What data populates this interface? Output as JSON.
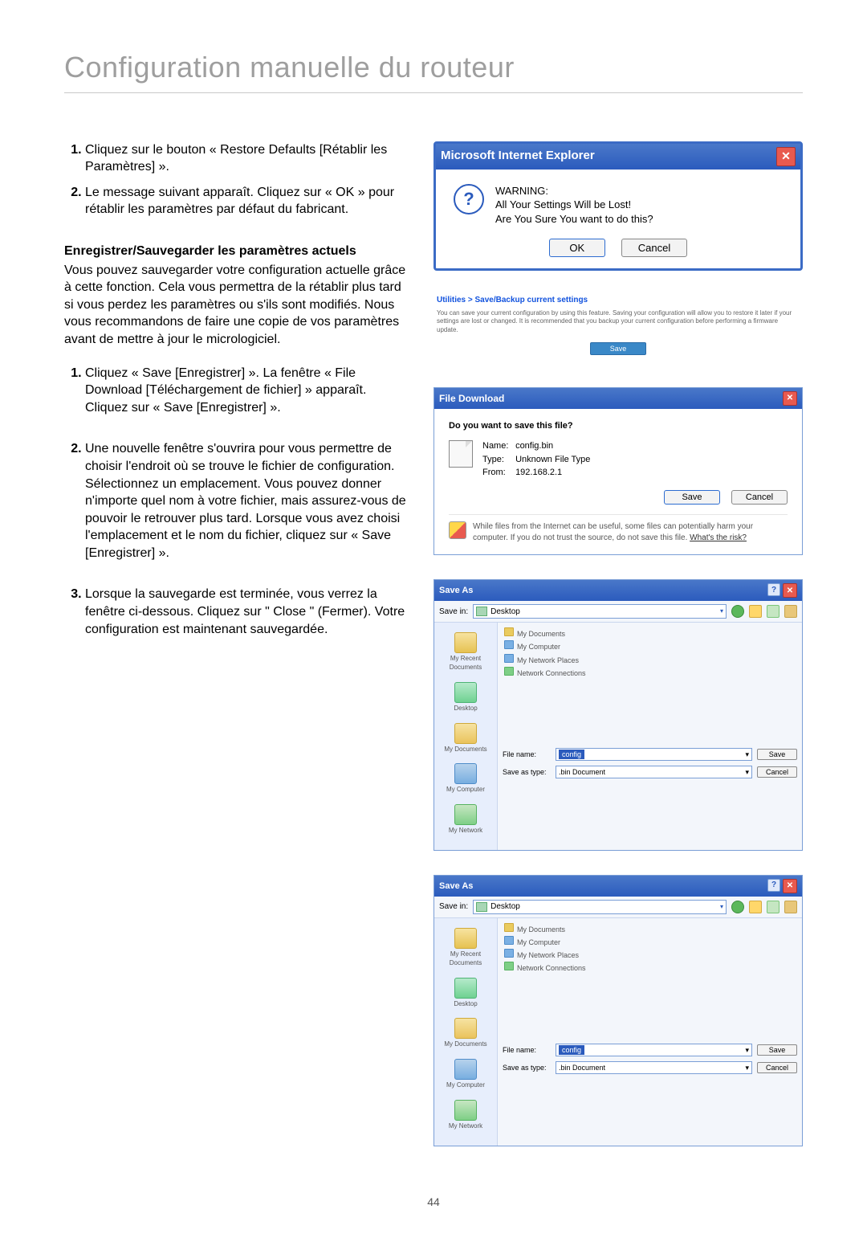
{
  "page": {
    "title": "Configuration manuelle du routeur",
    "number": "44"
  },
  "intro_steps": [
    "Cliquez sur le bouton « Restore Defaults [Rétablir les Paramètres] ».",
    "Le message suivant apparaît. Cliquez sur « OK » pour rétablir les paramètres par défaut du fabricant."
  ],
  "save_section": {
    "heading": "Enregistrer/Sauvegarder les paramètres actuels",
    "paragraph": "Vous pouvez sauvegarder votre configuration actuelle grâce à cette fonction. Cela vous permettra de la rétablir plus tard si vous perdez les paramètres ou s'ils sont modifiés. Nous vous recommandons de faire une copie de vos paramètres avant de mettre à jour le micrologiciel."
  },
  "save_steps": [
    "Cliquez « Save [Enregistrer] ». La fenêtre « File Download [Téléchargement de fichier] » apparaît. Cliquez sur « Save [Enregistrer] ».",
    "Une nouvelle fenêtre s'ouvrira pour vous permettre de choisir l'endroit où se trouve le fichier de configuration. Sélectionnez un emplacement. Vous pouvez donner n'importe quel nom à votre fichier, mais assurez-vous de pouvoir le retrouver plus tard. Lorsque vous avez choisi l'emplacement et le nom du fichier, cliquez sur « Save [Enregistrer] ».",
    "Lorsque la sauvegarde est terminée, vous verrez la fenêtre ci-dessous. Cliquez sur \" Close \" (Fermer). Votre configuration est maintenant sauvegardée."
  ],
  "ie_dialog": {
    "title": "Microsoft Internet Explorer",
    "line1": "WARNING:",
    "line2": "All Your Settings Will be Lost!",
    "line3": "Are You Sure You want to do this?",
    "ok": "OK",
    "cancel": "Cancel"
  },
  "util_panel": {
    "breadcrumb": "Utilities > Save/Backup current settings",
    "desc": "You can save your current configuration by using this feature. Saving your configuration will allow you to restore it later if your settings are lost or changed. It is recommended that you backup your current configuration before performing a firmware update.",
    "save": "Save"
  },
  "file_download": {
    "title": "File Download",
    "prompt": "Do you want to save this file?",
    "name_label": "Name:",
    "name_value": "config.bin",
    "type_label": "Type:",
    "type_value": "Unknown File Type",
    "from_label": "From:",
    "from_value": "192.168.2.1",
    "save": "Save",
    "cancel": "Cancel",
    "note": "While files from the Internet can be useful, some files can potentially harm your computer. If you do not trust the source, do not save this file.",
    "risk": "What's the risk?"
  },
  "saveas_common": {
    "title": "Save As",
    "savein_label": "Save in:",
    "savein_value": "Desktop",
    "side": {
      "recent": "My Recent Documents",
      "desktop": "Desktop",
      "docs": "My Documents",
      "computer": "My Computer",
      "network": "My Network"
    },
    "filename_label": "File name:",
    "saveastype_label": "Save as type:",
    "filename_value": "config",
    "saveastype_value": ".bin Document",
    "save": "Save",
    "cancel": "Cancel"
  },
  "saveas1_items": [
    "My Documents",
    "My Computer",
    "My Network Places",
    "Network Connections"
  ],
  "saveas2_items": [
    "My Documents",
    "My Computer",
    "My Network Places",
    "Network Connections"
  ]
}
